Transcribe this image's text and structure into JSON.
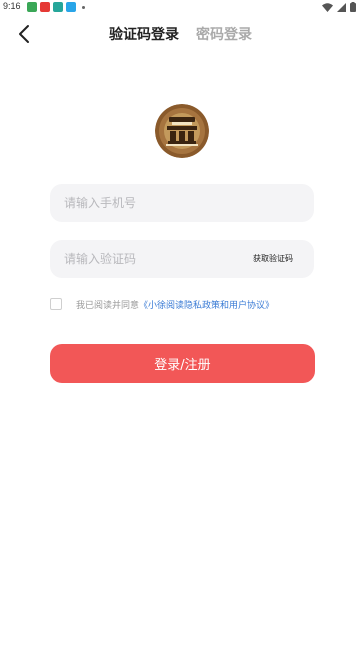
{
  "status_bar": {
    "time": "9:16",
    "notification_icons": [
      "app-green-icon",
      "app-red-icon",
      "app-teal-icon",
      "app-blue-icon"
    ],
    "system_icons": [
      "wifi-icon",
      "signal-icon",
      "battery-icon"
    ]
  },
  "nav": {
    "back_icon": "chevron-left-icon",
    "tabs": [
      {
        "label": "验证码登录",
        "active": true
      },
      {
        "label": "密码登录",
        "active": false
      }
    ]
  },
  "logo": {
    "icon": "brand-logo-icon"
  },
  "form": {
    "phone_placeholder": "请输入手机号",
    "code_placeholder": "请输入验证码",
    "get_code_label": "获取验证码"
  },
  "agreement": {
    "checked": false,
    "prefix": "我已阅读并同意",
    "link": "《小徐阅读隐私政策和用户协议》"
  },
  "submit": {
    "label": "登录/注册"
  },
  "colors": {
    "primary": "#f25757",
    "link": "#3a7bd5",
    "field_bg": "#f4f4f6",
    "inactive_tab": "#aaaaaa"
  }
}
